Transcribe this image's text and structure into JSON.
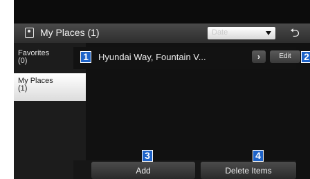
{
  "header": {
    "title": "My Places (1)",
    "sort_value": "Date",
    "back_icon": "back-arrow-icon",
    "place_icon": "my-places-icon"
  },
  "sidebar": {
    "items": [
      {
        "label": "Favorites\n(0)",
        "selected": false
      },
      {
        "label": "My Places\n(1)",
        "selected": true
      }
    ]
  },
  "list": {
    "rows": [
      {
        "name": "Hyundai Way, Fountain V...",
        "detail_icon": "chevron-right-icon",
        "edit_label": "Edit"
      }
    ]
  },
  "footer": {
    "add_label": "Add",
    "delete_label": "Delete Items"
  },
  "callouts": [
    "1",
    "2",
    "3",
    "4"
  ],
  "colors": {
    "callout": "#1e63c8",
    "background": "#111111",
    "selected_tab": "#ffffff"
  }
}
